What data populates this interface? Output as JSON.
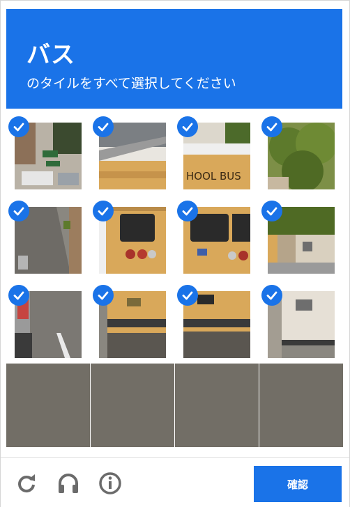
{
  "header": {
    "title": "バス",
    "subtitle": "のタイルをすべて選択してください"
  },
  "footer": {
    "reload_icon": "reload-icon",
    "audio_icon": "headphones-icon",
    "info_icon": "info-icon",
    "verify_label": "確認"
  },
  "tiles": [
    {
      "row": 0,
      "col": 0,
      "selected": true,
      "scene": "street-corner"
    },
    {
      "row": 0,
      "col": 1,
      "selected": true,
      "scene": "bus-top-left"
    },
    {
      "row": 0,
      "col": 2,
      "selected": true,
      "scene": "bus-top-right"
    },
    {
      "row": 0,
      "col": 3,
      "selected": true,
      "scene": "tree"
    },
    {
      "row": 1,
      "col": 0,
      "selected": true,
      "scene": "road-left"
    },
    {
      "row": 1,
      "col": 1,
      "selected": true,
      "scene": "bus-mid-left"
    },
    {
      "row": 1,
      "col": 2,
      "selected": true,
      "scene": "bus-mid-right"
    },
    {
      "row": 1,
      "col": 3,
      "selected": true,
      "scene": "house"
    },
    {
      "row": 2,
      "col": 0,
      "selected": true,
      "scene": "car-lane"
    },
    {
      "row": 2,
      "col": 1,
      "selected": true,
      "scene": "bus-bottom-left"
    },
    {
      "row": 2,
      "col": 2,
      "selected": true,
      "scene": "bus-bottom-right"
    },
    {
      "row": 2,
      "col": 3,
      "selected": true,
      "scene": "trailer"
    },
    {
      "row": 3,
      "col": 0,
      "selected": false,
      "scene": "asphalt"
    },
    {
      "row": 3,
      "col": 1,
      "selected": false,
      "scene": "asphalt"
    },
    {
      "row": 3,
      "col": 2,
      "selected": false,
      "scene": "asphalt"
    },
    {
      "row": 3,
      "col": 3,
      "selected": false,
      "scene": "asphalt"
    }
  ],
  "colors": {
    "accent": "#1a73e8",
    "bus_yellow": "#d9a85a",
    "asphalt": "#6e6a63",
    "foliage": "#5d7a2c"
  }
}
